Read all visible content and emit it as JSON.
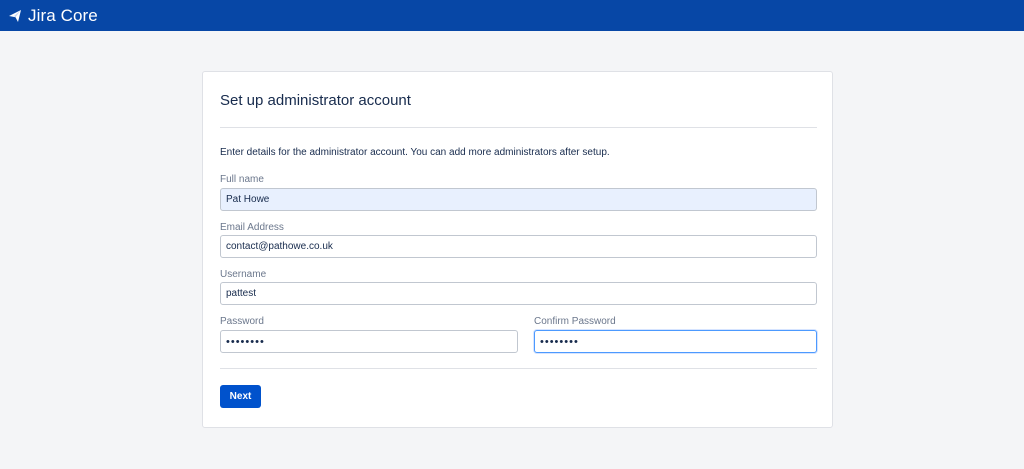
{
  "header": {
    "product_name": "Jira Core",
    "logo_icon": "jira-arrow-icon",
    "background_color": "#0747a6"
  },
  "form": {
    "title": "Set up administrator account",
    "intro": "Enter details for the administrator account. You can add more administrators after setup.",
    "full_name": {
      "label": "Full name",
      "value": "Pat Howe"
    },
    "email": {
      "label": "Email Address",
      "value": "contact@pathowe.co.uk"
    },
    "username": {
      "label": "Username",
      "value": "pattest"
    },
    "password": {
      "label": "Password",
      "value": "••••••••"
    },
    "confirm_password": {
      "label": "Confirm Password",
      "value": "••••••••"
    },
    "next_label": "Next",
    "accent_color": "#0052cc"
  }
}
